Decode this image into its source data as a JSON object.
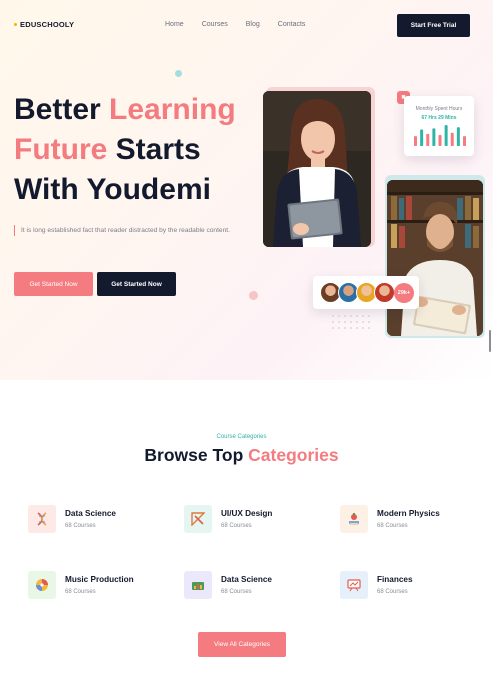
{
  "brand": {
    "name": "EDUSCHOOLY"
  },
  "nav": {
    "items": [
      "Home",
      "Courses",
      "Blog",
      "Contacts"
    ],
    "cta": "Start Free Trial"
  },
  "hero": {
    "title_line1": "Better",
    "title_line1_accent": "Learning",
    "title_line2_accent": "Future",
    "title_line2": "Starts",
    "title_line3": "With Youdemi",
    "description": "It is long established fact that reader distracted by the readable content.",
    "primary_button": "Get Started Now",
    "secondary_button": "Get Started Now"
  },
  "stats_card": {
    "label": "Monthly Spent Hours",
    "value": "67 Hrs 29 Mins",
    "bars": [
      0.45,
      0.75,
      0.55,
      0.8,
      0.5,
      0.95,
      0.6,
      0.85,
      0.45
    ]
  },
  "students_card": {
    "count_label": "29k+"
  },
  "categories": {
    "eyebrow": "Course Categories",
    "title": "Browse Top",
    "title_accent": "Categories",
    "items": [
      {
        "name": "Data Science",
        "count": "68 Courses",
        "icon": "dna-icon"
      },
      {
        "name": "UI/UX Design",
        "count": "68 Courses",
        "icon": "design-tools-icon"
      },
      {
        "name": "Modern Physics",
        "count": "68 Courses",
        "icon": "physics-book-icon"
      },
      {
        "name": "Music Production",
        "count": "68 Courses",
        "icon": "music-disc-icon"
      },
      {
        "name": "Data Science",
        "count": "68 Courses",
        "icon": "data-chart-icon"
      },
      {
        "name": "Finances",
        "count": "68 Courses",
        "icon": "finance-board-icon"
      }
    ],
    "view_all": "View All Categories"
  },
  "colors": {
    "accent": "#f47b7f",
    "dark": "#141a2e",
    "teal": "#2fb4a6"
  }
}
